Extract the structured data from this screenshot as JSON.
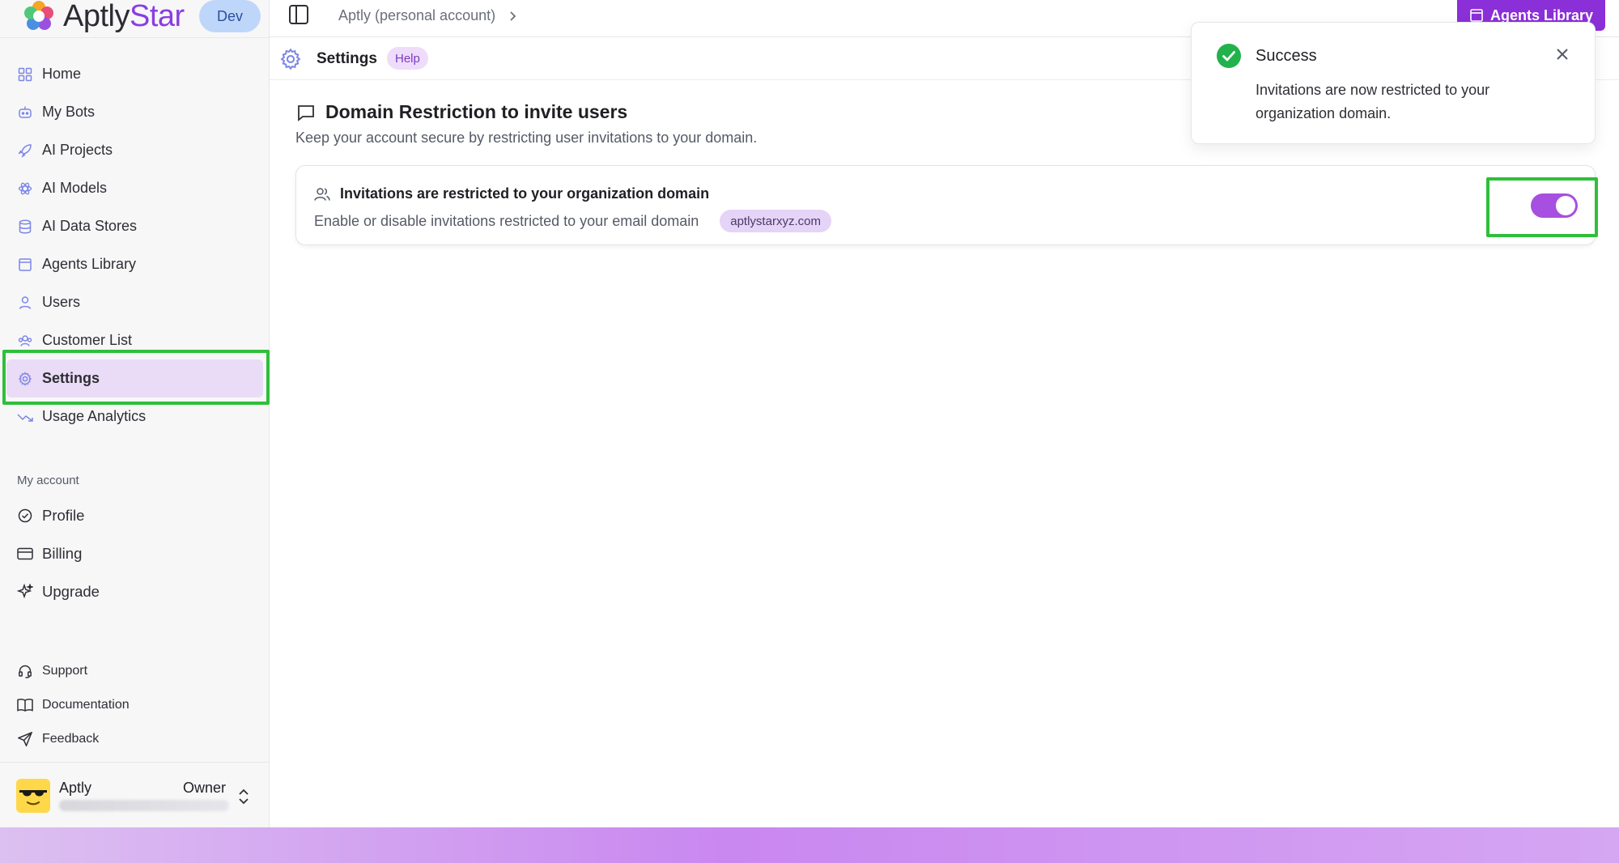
{
  "app": {
    "brand_main": "Aptly",
    "brand_accent": "Star",
    "env": "Dev"
  },
  "topbar": {
    "breadcrumb": "Aptly (personal account)",
    "agents_button": "Agents Library"
  },
  "sidebar": {
    "items": [
      {
        "label": "Home",
        "icon": "home-icon"
      },
      {
        "label": "My Bots",
        "icon": "bot-icon"
      },
      {
        "label": "AI Projects",
        "icon": "rocket-icon"
      },
      {
        "label": "AI Models",
        "icon": "atom-icon"
      },
      {
        "label": "AI Data Stores",
        "icon": "database-icon"
      },
      {
        "label": "Agents Library",
        "icon": "library-icon"
      },
      {
        "label": "Users",
        "icon": "user-icon"
      },
      {
        "label": "Customer List",
        "icon": "users-icon"
      },
      {
        "label": "Settings",
        "icon": "gear-icon",
        "active": true
      },
      {
        "label": "Usage Analytics",
        "icon": "trend-icon"
      }
    ],
    "account_label": "My account",
    "account_items": [
      {
        "label": "Profile",
        "icon": "check-circle-icon"
      },
      {
        "label": "Billing",
        "icon": "card-icon"
      },
      {
        "label": "Upgrade",
        "icon": "sparkle-icon"
      }
    ],
    "footer_items": [
      {
        "label": "Support",
        "icon": "headset-icon"
      },
      {
        "label": "Documentation",
        "icon": "book-icon"
      },
      {
        "label": "Feedback",
        "icon": "send-icon"
      }
    ],
    "user": {
      "name": "Aptly",
      "role": "Owner"
    }
  },
  "page": {
    "title": "Settings",
    "help": "Help"
  },
  "section": {
    "title": "Domain Restriction to invite users",
    "subtitle": "Keep your account secure by restricting user invitations to your domain."
  },
  "card": {
    "title": "Invitations are restricted to your organization domain",
    "description": "Enable or disable invitations restricted to your email domain",
    "domain": "aptlystarxyz.com",
    "toggle_on": true
  },
  "toast": {
    "title": "Success",
    "message": "Invitations are now restricted to your organization domain."
  },
  "colors": {
    "accent": "#8b2fd8",
    "toggle": "#a74fe0",
    "success": "#22b24c",
    "highlight": "#2fbf3a"
  }
}
